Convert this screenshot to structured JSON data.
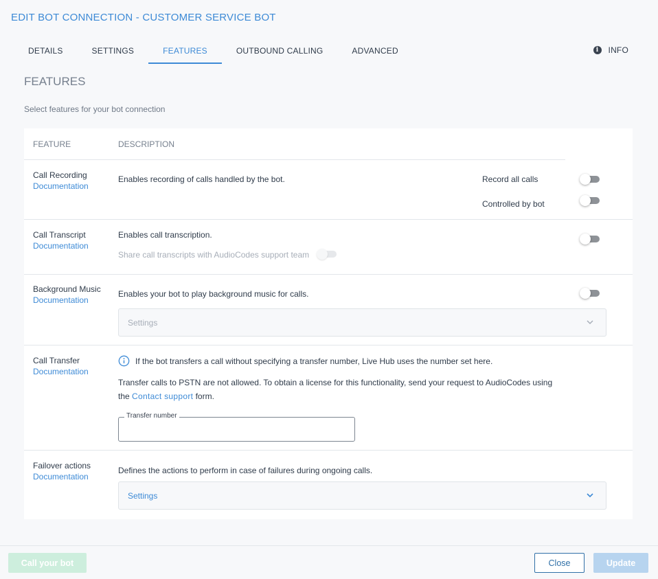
{
  "dialog": {
    "title": "EDIT BOT CONNECTION - CUSTOMER SERVICE BOT"
  },
  "tabs": [
    {
      "label": "DETAILS"
    },
    {
      "label": "SETTINGS"
    },
    {
      "label": "FEATURES"
    },
    {
      "label": "OUTBOUND CALLING"
    },
    {
      "label": "ADVANCED"
    }
  ],
  "active_tab": "FEATURES",
  "info_tab": {
    "label": "INFO",
    "icon": "info-icon"
  },
  "section": {
    "title": "FEATURES",
    "subtitle": "Select features for your bot connection"
  },
  "table": {
    "headers": {
      "feature": "FEATURE",
      "description": "DESCRIPTION"
    }
  },
  "features": {
    "call_recording": {
      "name": "Call Recording",
      "doc": "Documentation",
      "description": "Enables recording of calls handled by the bot.",
      "options": [
        {
          "label": "Record all calls",
          "enabled": false
        },
        {
          "label": "Controlled by bot",
          "enabled": false
        }
      ]
    },
    "call_transcript": {
      "name": "Call Transcript",
      "doc": "Documentation",
      "description": "Enables call transcription.",
      "enabled": false,
      "share_label": "Share call transcripts with AudioCodes support team",
      "share_enabled": false
    },
    "background_music": {
      "name": "Background Music",
      "doc": "Documentation",
      "description": "Enables your bot to play background music for calls.",
      "enabled": false,
      "settings_label": "Settings"
    },
    "call_transfer": {
      "name": "Call Transfer",
      "doc": "Documentation",
      "info": "If the bot transfers a call without specifying a transfer number, Live Hub uses the number set here.",
      "notice_line1": "Transfer calls to PSTN are not allowed. To obtain a license for this functionality, send your request to AudioCodes using",
      "notice_prefix": "the",
      "notice_link": "Contact support",
      "notice_suffix": "form.",
      "transfer_number_label": "Transfer number",
      "transfer_number_value": ""
    },
    "failover": {
      "name": "Failover actions",
      "doc": "Documentation",
      "description": "Defines the actions to perform in case of failures during ongoing calls.",
      "settings_label": "Settings"
    }
  },
  "footer": {
    "call_bot": "Call your bot",
    "close": "Close",
    "update": "Update"
  },
  "colors": {
    "accent": "#3d8ad6",
    "toggle_off": "#8e9297",
    "call_button_disabled": "#cdeedd",
    "update_button_disabled": "#b7d4ef"
  }
}
